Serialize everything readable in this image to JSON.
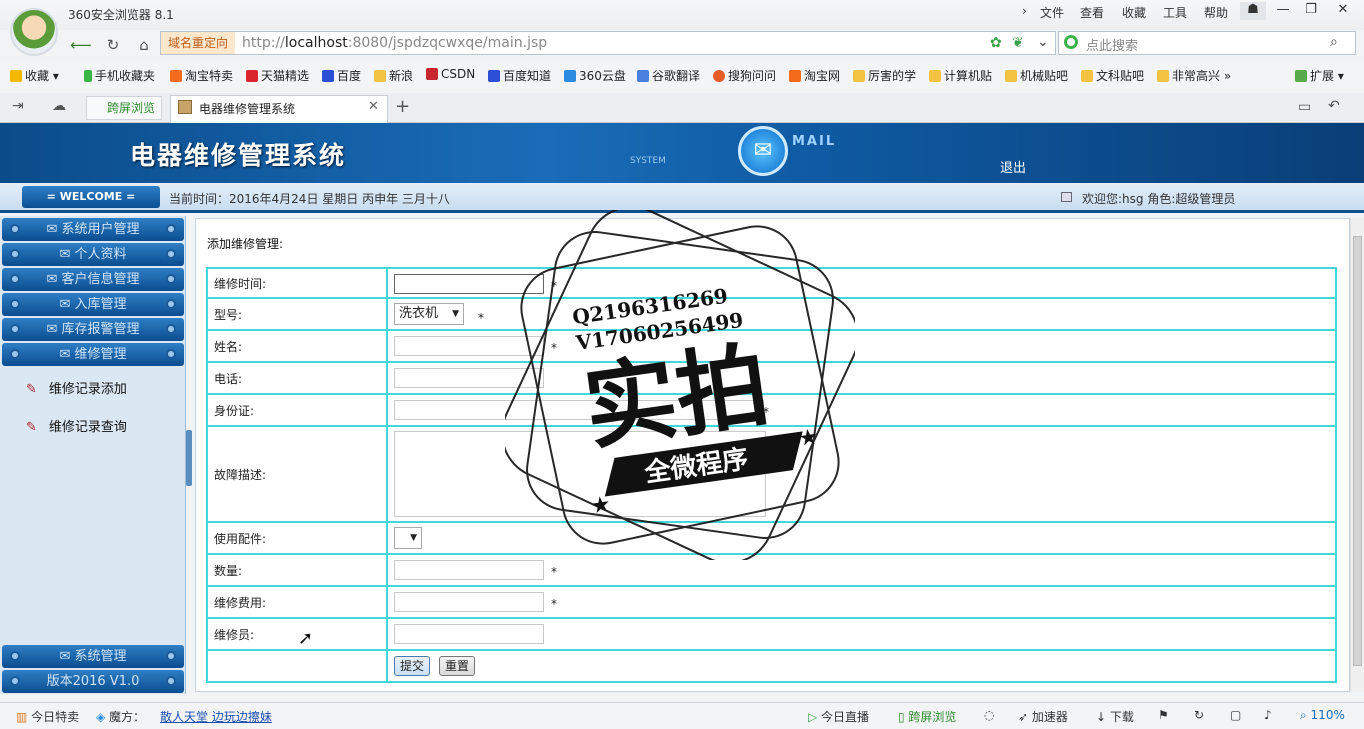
{
  "browser": {
    "app_name": "360安全浏览器 8.1",
    "menus": [
      "文件",
      "查看",
      "收藏",
      "工具",
      "帮助"
    ],
    "redirect_label": "域名重定向",
    "url_host": "localhost",
    "url_pre": "http://",
    "url_rest": ":8080/jspdzqcwxqe/main.jsp",
    "search_placeholder": "点此搜索",
    "bookmarks": [
      "收藏",
      "手机收藏夹",
      "淘宝特卖",
      "天猫精选",
      "百度",
      "新浪",
      "CSDN",
      "百度知道",
      "360云盘",
      "谷歌翻译",
      "搜狗问问",
      "淘宝网",
      "厉害的学",
      "计算机贴",
      "机械贴吧",
      "文科贴吧",
      "非常高兴"
    ],
    "extend_label": "扩展",
    "tab_split": "跨屏浏览",
    "tab_active": "电器维修管理系统"
  },
  "header": {
    "system_title": "电器维修管理系统",
    "system_label": "SYSTEM",
    "mail_label": "MAIL",
    "logout": "退出",
    "welcome": "= WELCOME =",
    "current_time": "当前时间：2016年4月24日 星期日 丙申年 三月十八",
    "user_info": "欢迎您:hsg 角色:超级管理员"
  },
  "sidebar": {
    "menus": [
      "系统用户管理",
      "个人资料",
      "客户信息管理",
      "入库管理",
      "库存报警管理",
      "维修管理"
    ],
    "sub_items": [
      "维修记录添加",
      "维修记录查询"
    ],
    "bottom": [
      "系统管理",
      "版本2016 V1.0"
    ]
  },
  "form": {
    "title": "添加维修管理:",
    "fields": [
      "维修时间:",
      "型号:",
      "姓名:",
      "电话:",
      "身份证:",
      "故障描述:",
      "使用配件:",
      "数量:",
      "维修费用:",
      "维修员:"
    ],
    "model_value": "洗衣机",
    "required_mark": "*",
    "submit": "提交",
    "reset": "重置"
  },
  "watermark": {
    "line1": "Q2196316269",
    "line2": "V17060256499",
    "big": "实拍",
    "banner": "全微程序"
  },
  "statusbar": {
    "items": [
      "今日特卖",
      "魔方：",
      "散人天堂 边玩边擦妹",
      "今日直播",
      "跨屏浏览",
      "加速器",
      "下载"
    ],
    "zoom": "110%"
  }
}
